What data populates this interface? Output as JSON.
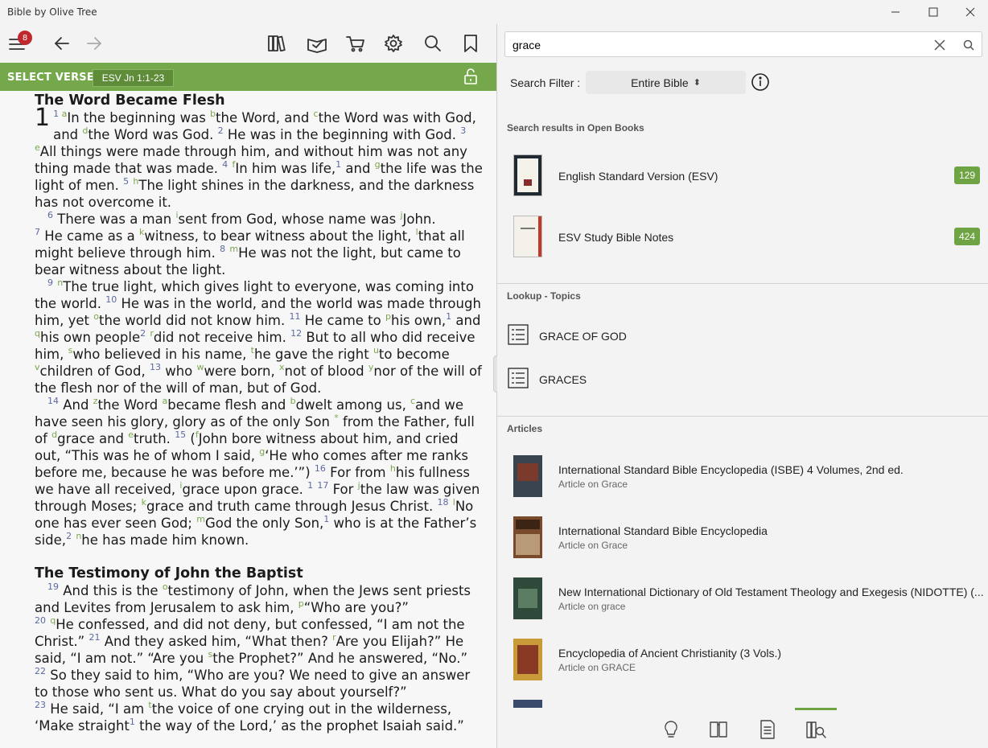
{
  "window": {
    "title": "Bible by Olive Tree"
  },
  "toolbar": {
    "menu_badge": "8"
  },
  "verse_bar": {
    "label": "SELECT VERSE",
    "reference": "ESV Jn 1:1-23"
  },
  "reader": {
    "heading1": "The Word Became Flesh",
    "heading2": "The Testimony of John the Baptist"
  },
  "search": {
    "query": "grace",
    "placeholder": ""
  },
  "filter": {
    "label": "Search Filter :",
    "value": "Entire Bible"
  },
  "open_books": {
    "header": "Search results in Open Books",
    "items": [
      {
        "name": "English Standard Version (ESV)",
        "count": "129"
      },
      {
        "name": "ESV Study Bible Notes",
        "count": "424"
      }
    ]
  },
  "topics": {
    "header": "Lookup - Topics",
    "items": [
      {
        "name": "GRACE OF GOD"
      },
      {
        "name": "GRACES"
      }
    ]
  },
  "articles": {
    "header": "Articles",
    "items": [
      {
        "title": "International Standard Bible Encyclopedia (ISBE) 4 Volumes, 2nd ed.",
        "subtitle": "Article on Grace"
      },
      {
        "title": "International Standard Bible Encyclopedia",
        "subtitle": "Article on Grace"
      },
      {
        "title": "New International Dictionary of Old Testament Theology and Exegesis (NIDOTTE) (...",
        "subtitle": "Article on grace"
      },
      {
        "title": "Encyclopedia of Ancient Christianity (3 Vols.)",
        "subtitle": "Article on GRACE"
      }
    ]
  },
  "colors": {
    "accent": "#74a84a",
    "badge": "#c0282d",
    "count_badge": "#6fa444"
  }
}
